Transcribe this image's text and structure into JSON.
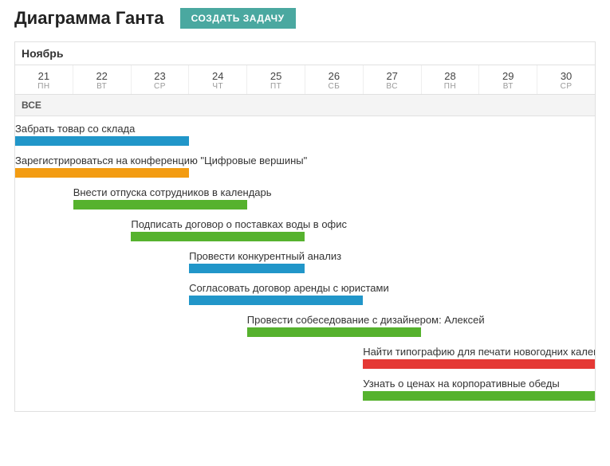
{
  "header": {
    "title": "Диаграмма Ганта",
    "create_button": "СОЗДАТЬ ЗАДАЧУ"
  },
  "calendar": {
    "month": "Ноябрь",
    "all_label": "ВСЕ",
    "days": [
      {
        "num": "21",
        "wk": "ПН"
      },
      {
        "num": "22",
        "wk": "ВТ"
      },
      {
        "num": "23",
        "wk": "СР"
      },
      {
        "num": "24",
        "wk": "ЧТ"
      },
      {
        "num": "25",
        "wk": "ПТ"
      },
      {
        "num": "26",
        "wk": "СБ"
      },
      {
        "num": "27",
        "wk": "ВС"
      },
      {
        "num": "28",
        "wk": "ПН"
      },
      {
        "num": "29",
        "wk": "ВТ"
      },
      {
        "num": "30",
        "wk": "СР"
      }
    ]
  },
  "tasks": [
    {
      "label": "Забрать товар со склада",
      "color": "blue"
    },
    {
      "label": "Зарегистрироваться на конференцию \"Цифровые вершины\"",
      "color": "orange"
    },
    {
      "label": "Внести отпуска сотрудников в календарь",
      "color": "green"
    },
    {
      "label": "Подписать договор о поставках воды в офис",
      "color": "green"
    },
    {
      "label": "Провести конкурентный анализ",
      "color": "blue"
    },
    {
      "label": "Согласовать договор аренды с юристами",
      "color": "blue"
    },
    {
      "label": "Провести собеседование с дизайнером: Алексей",
      "color": "green"
    },
    {
      "label": "Найти типографию для печати новогодних календарей",
      "color": "red"
    },
    {
      "label": "Узнать о ценах на корпоративные обеды",
      "color": "green"
    }
  ],
  "colors": {
    "blue": "#2196c9",
    "orange": "#f39c12",
    "green": "#56b22e",
    "red": "#e53935"
  },
  "chart_data": {
    "type": "bar",
    "title": "Диаграмма Ганта",
    "xlabel": "Ноябрь",
    "ylabel": "",
    "categories": [
      "21",
      "22",
      "23",
      "24",
      "25",
      "26",
      "27",
      "28",
      "29",
      "30"
    ],
    "series": [
      {
        "name": "Забрать товар со склада",
        "start": 21,
        "end": 24,
        "color": "blue"
      },
      {
        "name": "Зарегистрироваться на конференцию \"Цифровые вершины\"",
        "start": 21,
        "end": 24,
        "color": "orange"
      },
      {
        "name": "Внести отпуска сотрудников в календарь",
        "start": 22,
        "end": 25,
        "color": "green"
      },
      {
        "name": "Подписать договор о поставках воды в офис",
        "start": 23,
        "end": 26,
        "color": "green"
      },
      {
        "name": "Провести конкурентный анализ",
        "start": 24,
        "end": 26,
        "color": "blue"
      },
      {
        "name": "Согласовать договор аренды с юристами",
        "start": 24,
        "end": 27,
        "color": "blue"
      },
      {
        "name": "Провести собеседование с дизайнером: Алексей",
        "start": 25,
        "end": 28,
        "color": "green"
      },
      {
        "name": "Найти типографию для печати новогодних календарей",
        "start": 27,
        "end": 31,
        "color": "red"
      },
      {
        "name": "Узнать о ценах на корпоративные обеды",
        "start": 27,
        "end": 31,
        "color": "green"
      }
    ],
    "xlim": [
      21,
      30
    ]
  }
}
